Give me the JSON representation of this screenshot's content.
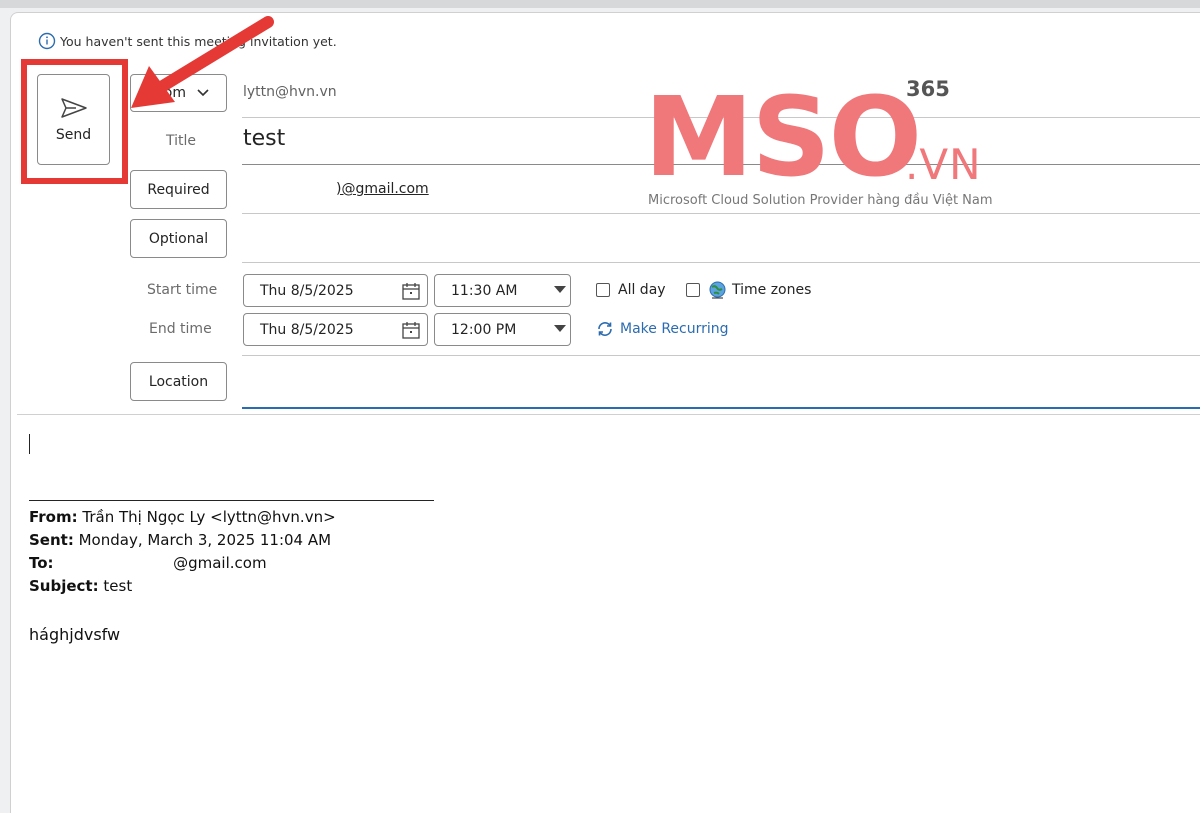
{
  "notice": {
    "text": "You haven't sent this meeting invitation yet."
  },
  "send_button": {
    "label": "Send"
  },
  "from": {
    "label": "From",
    "email": "lyttn@hvn.vn"
  },
  "title_field": {
    "label": "Title",
    "value": "test"
  },
  "required": {
    "label": "Required",
    "email": ")@gmail.com"
  },
  "optional": {
    "label": "Optional"
  },
  "start": {
    "label": "Start time",
    "date": "Thu 8/5/2025",
    "time": "11:30 AM"
  },
  "end": {
    "label": "End time",
    "date": "Thu 8/5/2025",
    "time": "12:00 PM"
  },
  "options": {
    "all_day": "All day",
    "time_zones": "Time zones",
    "make_recurring": "Make Recurring"
  },
  "location": {
    "label": "Location"
  },
  "reply": {
    "from_label": "From:",
    "from_value": "Trần Thị Ngọc Ly <lyttn@hvn.vn>",
    "sent_label": "Sent:",
    "sent_value": "Monday, March 3, 2025 11:04 AM",
    "to_label": "To:",
    "to_value": "@gmail.com",
    "subject_label": "Subject:",
    "subject_value": "test"
  },
  "body": {
    "text": "hághjdvsfw"
  },
  "watermark": {
    "brand": "MSO",
    "number": "365",
    "suffix": ".VN",
    "tagline": "Microsoft Cloud Solution Provider hàng đầu Việt Nam"
  },
  "colors": {
    "highlight": "#e53935",
    "accent_blue": "#2b6cb0",
    "watermark": "#f0777a"
  }
}
